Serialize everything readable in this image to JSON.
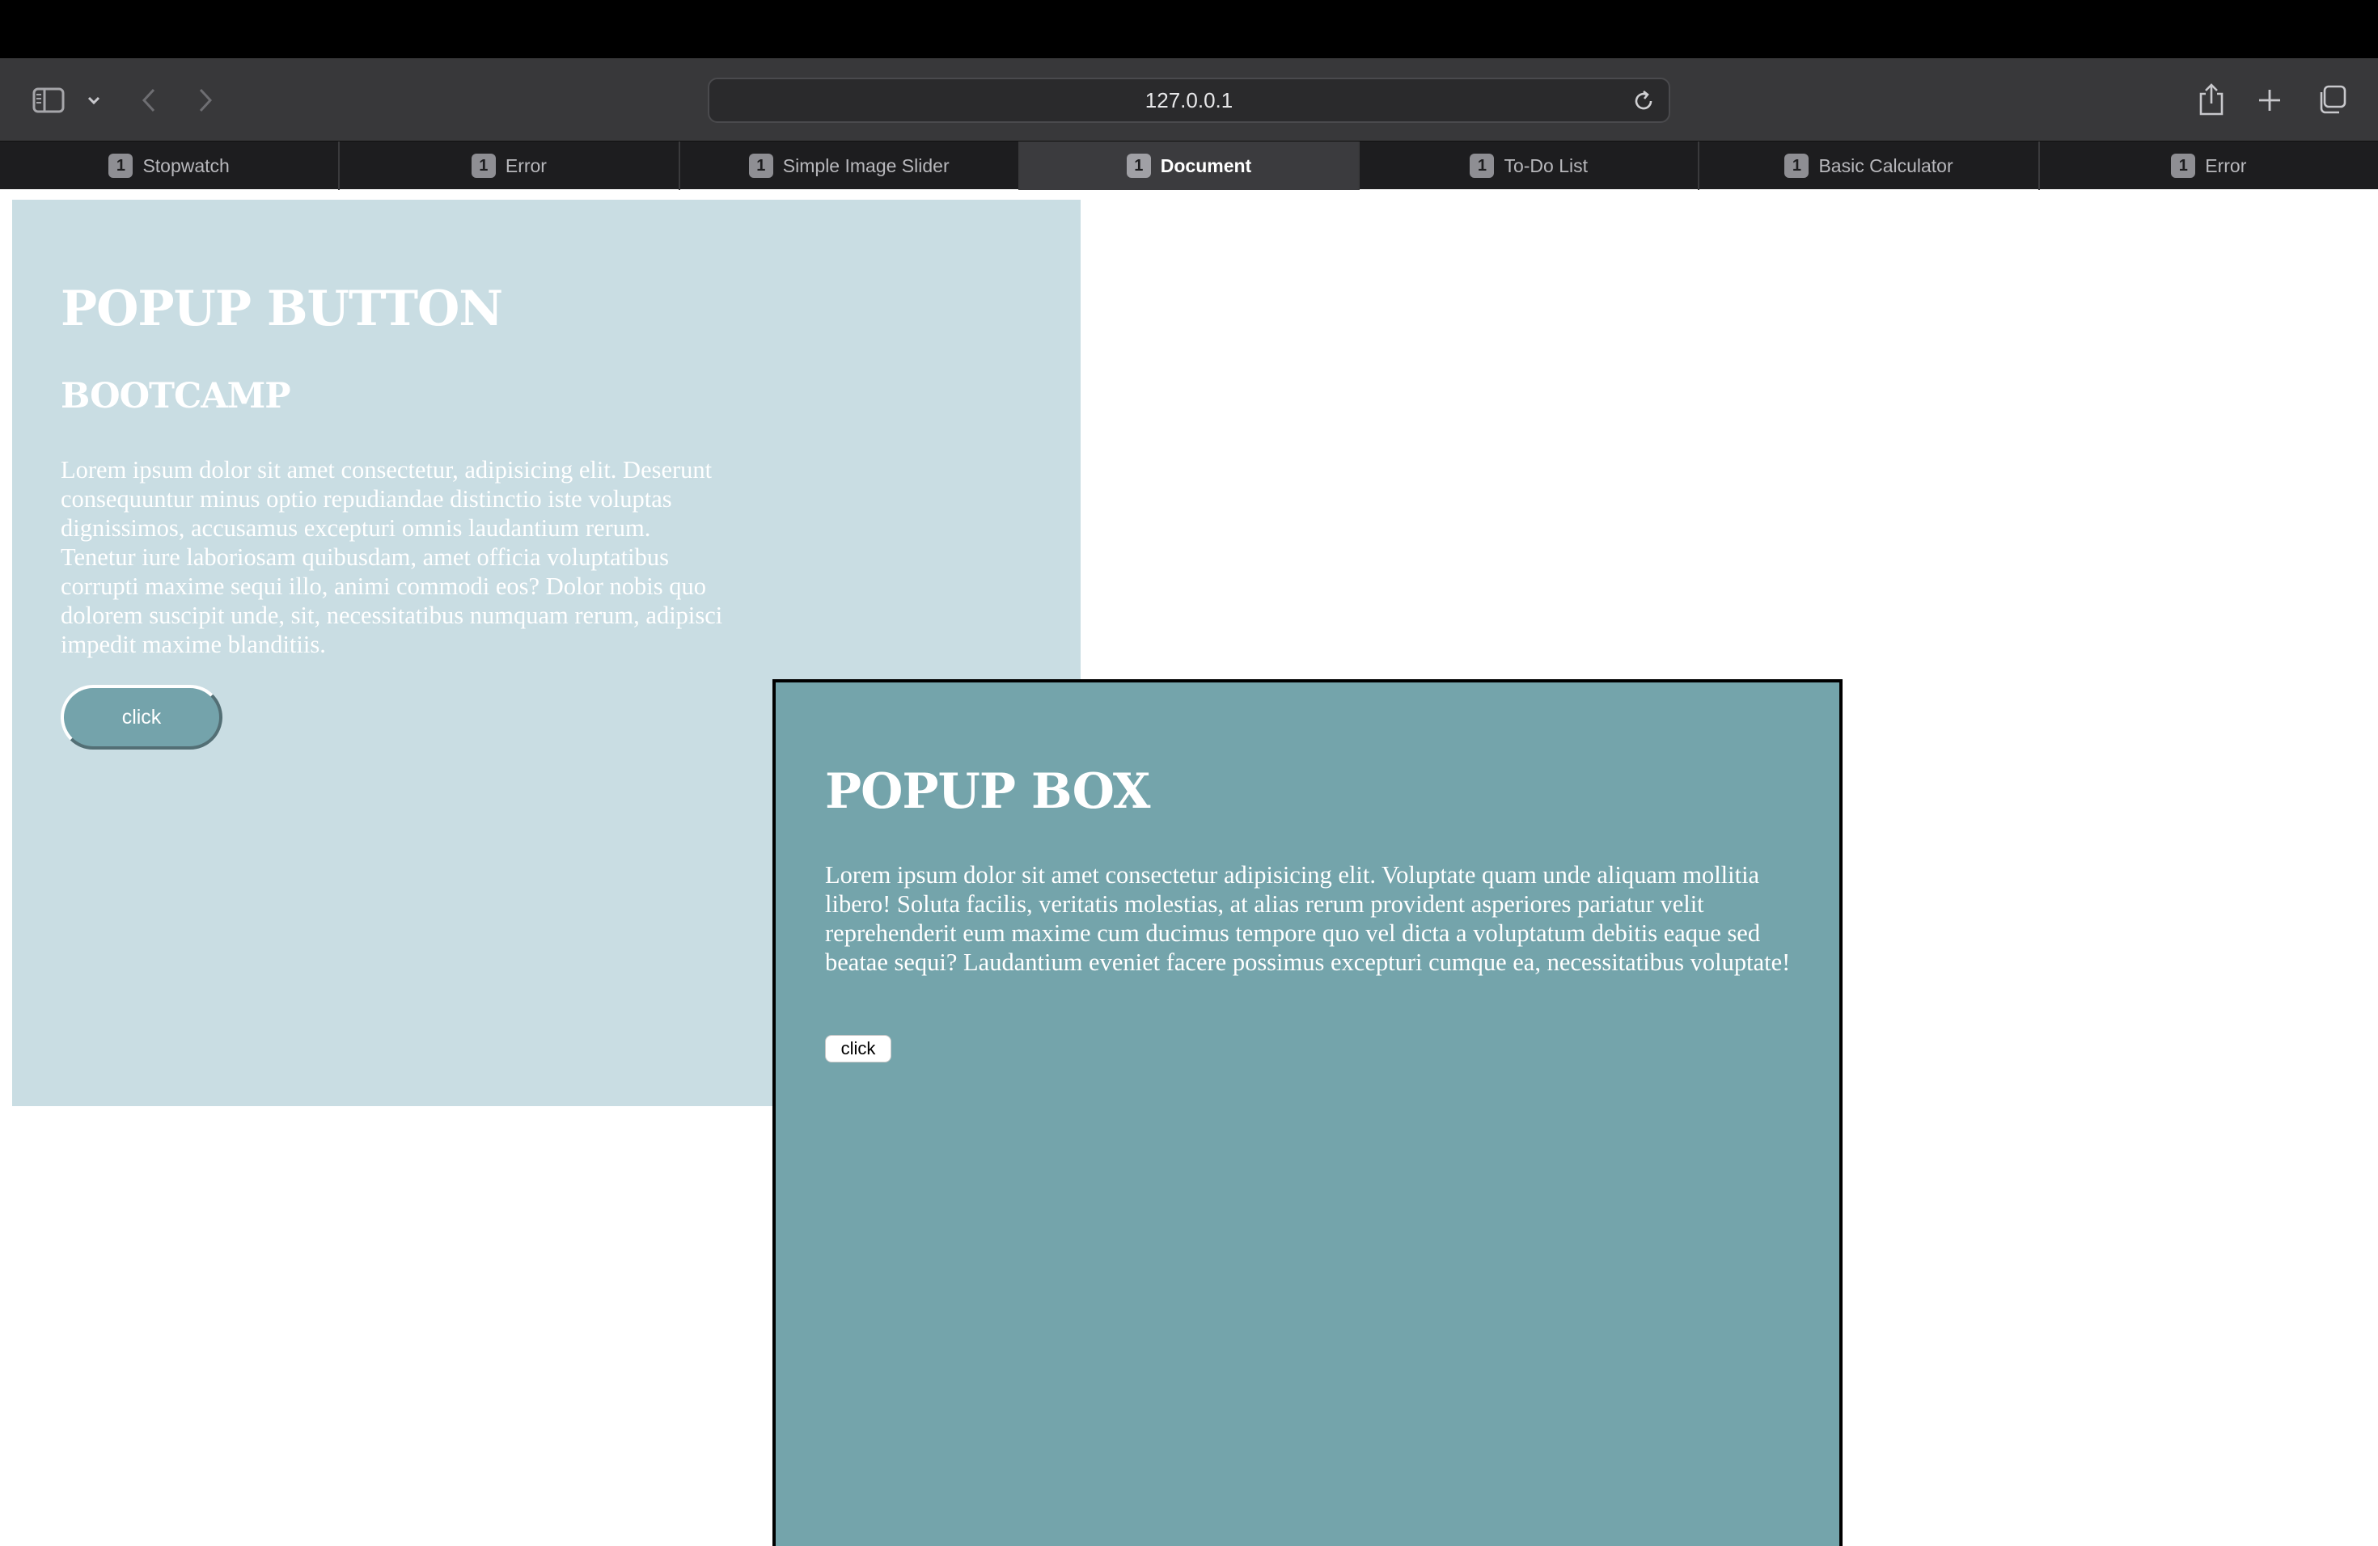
{
  "browser": {
    "url": "127.0.0.1",
    "icons": {
      "sidebar": "sidebar-icon",
      "chevron": "chevron-down-icon",
      "back": "back-icon",
      "forward": "forward-icon",
      "reload": "reload-icon",
      "share": "share-icon",
      "new_tab": "plus-icon",
      "tabs_overview": "tabs-overview-icon"
    },
    "tabs": [
      {
        "badge": "1",
        "title": "Stopwatch",
        "active": false
      },
      {
        "badge": "1",
        "title": "Error",
        "active": false
      },
      {
        "badge": "1",
        "title": "Simple Image Slider",
        "active": false
      },
      {
        "badge": "1",
        "title": "Document",
        "active": true
      },
      {
        "badge": "1",
        "title": "To-Do List",
        "active": false
      },
      {
        "badge": "1",
        "title": "Basic Calculator",
        "active": false
      },
      {
        "badge": "1",
        "title": "Error",
        "active": false
      }
    ]
  },
  "page": {
    "panel": {
      "title": "POPUP BUTTON",
      "subtitle": "BOOTCAMP",
      "body": "Lorem ipsum dolor sit amet consectetur, adipisicing elit. Deserunt consequuntur minus optio repudiandae distinctio iste voluptas dignissimos, accusamus excepturi omnis laudantium rerum. Tenetur iure laboriosam quibusdam, amet officia voluptatibus corrupti maxime sequi illo, animi commodi eos? Dolor nobis quo dolorem suscipit unde, sit, necessitatibus numquam rerum, adipisci impedit maxime blanditiis.",
      "button_label": "click"
    },
    "popup": {
      "title": "POPUP BOX",
      "body": "Lorem ipsum dolor sit amet consectetur adipisicing elit. Voluptate quam unde aliquam mollitia libero! Soluta facilis, veritatis molestias, at alias rerum provident asperiores pariatur velit reprehenderit eum maxime cum ducimus tempore quo vel dicta a voluptatum debitis eaque sed beatae sequi? Laudantium eveniet facere possimus excepturi cumque ea, necessitatibus voluptate!",
      "button_label": "click"
    }
  },
  "colors": {
    "panel_bg": "#c9dde3",
    "popup_bg": "#74a4ab",
    "text": "#ffffff"
  }
}
